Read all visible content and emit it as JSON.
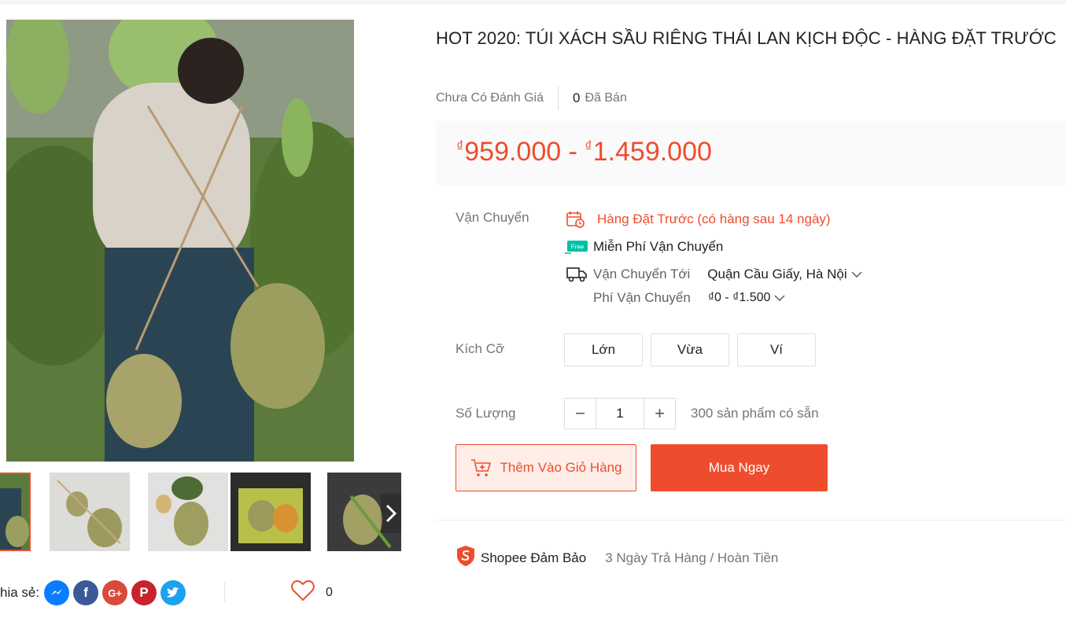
{
  "product": {
    "title": "HOT 2020: TÚI XÁCH SẦU RIÊNG THÁI LAN KỊCH ĐỘC - HÀNG ĐẶT TRƯỚC",
    "rating_text": "Chưa Có Đánh Giá",
    "sold_count": "0",
    "sold_label": "Đã Bán",
    "price_currency": "₫",
    "price_min": "959.000",
    "price_sep": "-",
    "price_max": "1.459.000"
  },
  "shipping": {
    "label": "Vận Chuyển",
    "preorder_text": "Hàng Đặt Trước (có hàng sau 14 ngày)",
    "free_badge": "Free",
    "free_text": "Miễn Phí Vận Chuyển",
    "to_label": "Vận Chuyển Tới",
    "to_value": "Quận Cầu Giấy, Hà Nội",
    "fee_label": "Phí Vận Chuyển",
    "fee_value": "₫0 - ₫1.500"
  },
  "size": {
    "label": "Kích Cỡ",
    "options": [
      "Lớn",
      "Vừa",
      "Ví"
    ]
  },
  "quantity": {
    "label": "Số Lượng",
    "minus": "−",
    "value": "1",
    "plus": "+",
    "stock_text": "300 sản phẩm có sẵn"
  },
  "actions": {
    "add_to_cart": "Thêm Vào Giỏ Hàng",
    "buy_now": "Mua Ngay"
  },
  "guarantee": {
    "title": "Shopee Đảm Bảo",
    "desc": "3 Ngày Trả Hàng / Hoàn Tiền"
  },
  "share": {
    "label": "hia sẻ:",
    "icons": [
      "messenger-icon",
      "facebook-icon",
      "google-plus-icon",
      "pinterest-icon",
      "twitter-icon"
    ]
  },
  "like": {
    "count": "0"
  },
  "colors": {
    "accent": "#ee4d2d",
    "price_bg": "#fafafa"
  }
}
